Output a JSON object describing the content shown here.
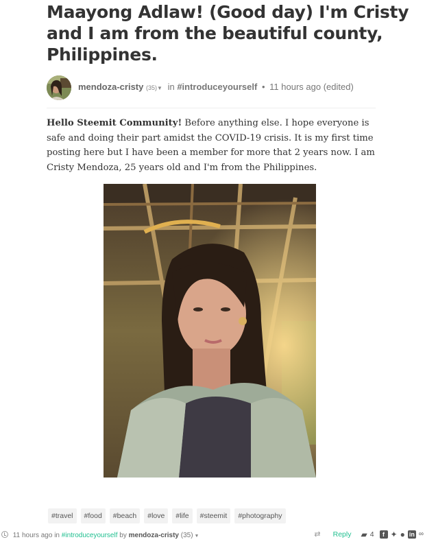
{
  "post": {
    "title": "Maayong Adlaw! (Good day) I'm Cristy and I am from the beautiful county, Philippines.",
    "author": "mendoza-cristy",
    "reputation": "(35)",
    "in_label": "in",
    "community": "#introduceyourself",
    "time": "11 hours ago (edited)",
    "body_lead": "Hello Steemit Community!",
    "body_rest": " Before anything else. I hope everyone is safe and doing their part amidst the COVID-19 crisis. It is my first time posting here but I have been a member for more that 2 years now. I am Cristy Mendoza, 25 years old and I'm from the Philippines."
  },
  "tags": [
    "#travel",
    "#food",
    "#beach",
    "#love",
    "#life",
    "#steemit",
    "#photography"
  ],
  "footer": {
    "time": "11 hours ago",
    "in_label": "in",
    "community": "#introduceyourself",
    "by_label": "by",
    "author": "mendoza-cristy",
    "reputation": "(35)",
    "reply_label": "Reply",
    "comment_count": "4"
  },
  "icons": {
    "resteem": "resteem-icon",
    "comments": "comments-icon",
    "facebook": "facebook-icon",
    "twitter": "twitter-icon",
    "reddit": "reddit-icon",
    "linkedin": "linkedin-icon",
    "link": "link-icon"
  },
  "colors": {
    "accent": "#1fbf8f",
    "tag_bg": "#f2f2f2",
    "text": "#333333"
  }
}
